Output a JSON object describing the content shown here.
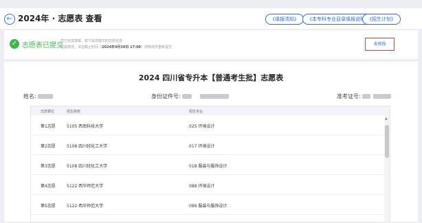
{
  "header": {
    "title": "2024年 · 志愿表 查看",
    "links": [
      "《填报须知》",
      "《本专科专业目录填报说明》",
      "《招生计划》"
    ]
  },
  "status": {
    "text": "志愿表已提交",
    "note_line1": "您已完成填报。如下是您提交的志愿信息",
    "note_line2_prefix": "若需修改，请在截止时间（",
    "note_deadline": "2024年4月30日 17:00",
    "note_line2_suffix": "）前修改并重新提交",
    "edit_label": "去修改"
  },
  "form": {
    "title": "2024 四川省专升本【普通考生批】志愿表",
    "name_label": "姓名:",
    "id_label": "身份证件号:",
    "exam_label": "准考证号:"
  },
  "table": {
    "headers": [
      "志愿顺位",
      "招生院校",
      "招生专业"
    ],
    "rows": [
      {
        "rank": "第1志愿",
        "school": "5105 西南科技大学",
        "major": "025 环境设计"
      },
      {
        "rank": "第2志愿",
        "school": "5108 四川轻化工大学",
        "major": "017 环境设计"
      },
      {
        "rank": "第3志愿",
        "school": "5108 四川轻化工大学",
        "major": "018 服装与服饰设计"
      },
      {
        "rank": "第4志愿",
        "school": "5122 西华师范大学",
        "major": "088 环境设计"
      },
      {
        "rank": "第5志愿",
        "school": "5122 西华师范大学",
        "major": "089 服装与服饰设计"
      }
    ]
  },
  "colors": {
    "accent": "#2f6bd8",
    "success": "#3db94a",
    "highlight": "#e43b3b"
  }
}
